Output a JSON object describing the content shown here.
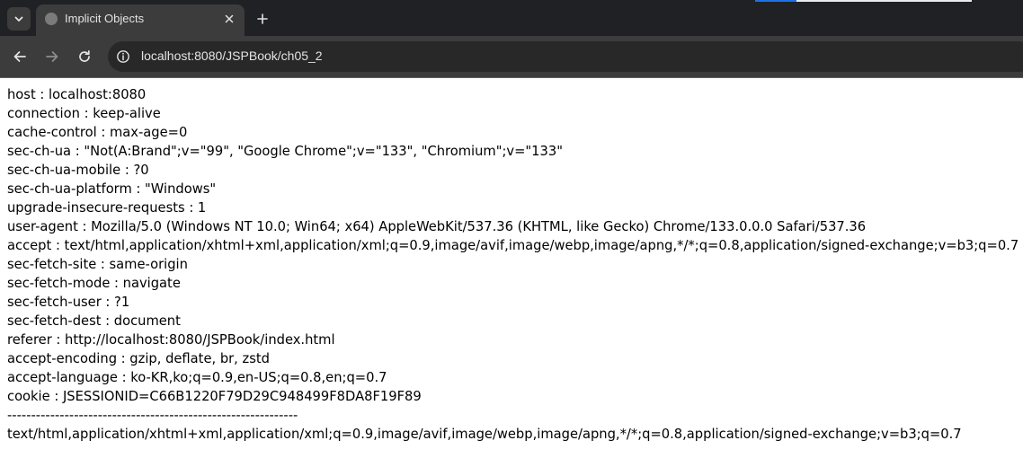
{
  "browser": {
    "tab": {
      "title": "Implicit Objects"
    },
    "address_bar": {
      "url": "localhost:8080/JSPBook/ch05_2"
    },
    "icons": {
      "tab_search": "chevron-down-icon",
      "tab_close": "close-icon",
      "new_tab": "plus-icon",
      "back": "arrow-left-icon",
      "forward": "arrow-right-icon",
      "reload": "reload-icon",
      "site_info": "info-icon"
    },
    "colors": {
      "tabstrip_bg": "#202124",
      "toolbar_bg": "#3c3c3c",
      "omnibox_bg": "#282828",
      "accent": "#1a73e8"
    }
  },
  "page": {
    "headers": [
      "host : localhost:8080",
      "connection : keep-alive",
      "cache-control : max-age=0",
      "sec-ch-ua : \"Not(A:Brand\";v=\"99\", \"Google Chrome\";v=\"133\", \"Chromium\";v=\"133\"",
      "sec-ch-ua-mobile : ?0",
      "sec-ch-ua-platform : \"Windows\"",
      "upgrade-insecure-requests : 1",
      "user-agent : Mozilla/5.0 (Windows NT 10.0; Win64; x64) AppleWebKit/537.36 (KHTML, like Gecko) Chrome/133.0.0.0 Safari/537.36",
      "accept : text/html,application/xhtml+xml,application/xml;q=0.9,image/avif,image/webp,image/apng,*/*;q=0.8,application/signed-exchange;v=b3;q=0.7",
      "sec-fetch-site : same-origin",
      "sec-fetch-mode : navigate",
      "sec-fetch-user : ?1",
      "sec-fetch-dest : document",
      "referer : http://localhost:8080/JSPBook/index.html",
      "accept-encoding : gzip, deflate, br, zstd",
      "accept-language : ko-KR,ko;q=0.9,en-US;q=0.8,en;q=0.7",
      "cookie : JSESSIONID=C66B1220F79D29C948499F8DA8F19F89"
    ],
    "separator": "-------------------------------------------------------------",
    "accept_value": "text/html,application/xhtml+xml,application/xml;q=0.9,image/avif,image/webp,image/apng,*/*;q=0.8,application/signed-exchange;v=b3;q=0.7"
  }
}
